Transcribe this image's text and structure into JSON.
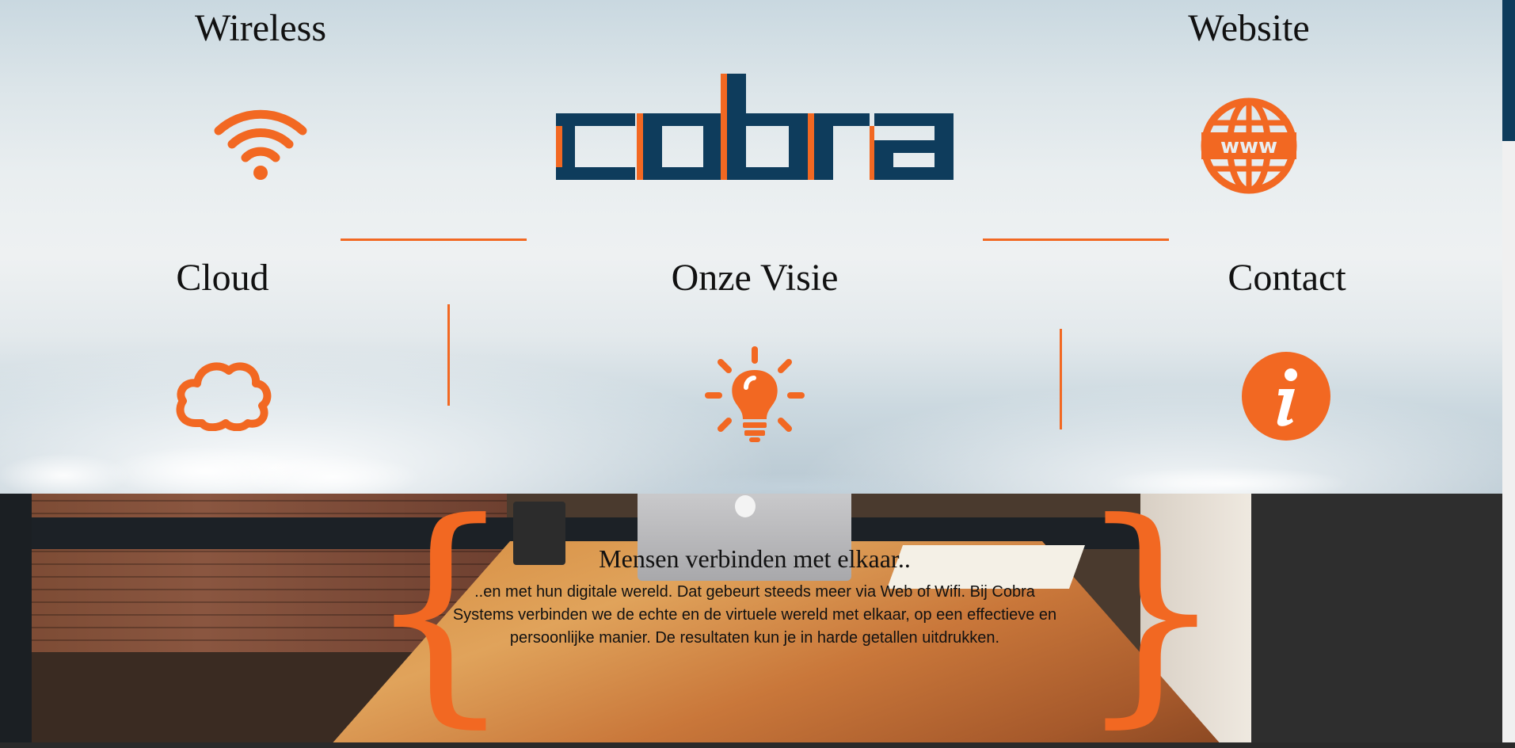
{
  "tiles": {
    "wireless": {
      "title": "Wireless",
      "icon": "wifi-icon"
    },
    "website": {
      "title": "Website",
      "icon": "globe-www-icon"
    },
    "cloud": {
      "title": "Cloud",
      "icon": "cloud-icon"
    },
    "visie": {
      "title": "Onze Visie",
      "icon": "lightbulb-icon"
    },
    "contact": {
      "title": "Contact",
      "icon": "info-icon"
    }
  },
  "logo": {
    "text": "cobra"
  },
  "quote": {
    "title": "Mensen verbinden met elkaar..",
    "text": "..en met hun digitale wereld. Dat gebeurt steeds meer via Web of Wifi. Bij Cobra Systems verbinden we de echte en de virtuele wereld met elkaar, op een effectieve en persoonlijke manier. De resultaten kun je in harde getallen uitdrukken."
  },
  "colors": {
    "accent": "#f26822",
    "brand": "#0e3c5c"
  }
}
